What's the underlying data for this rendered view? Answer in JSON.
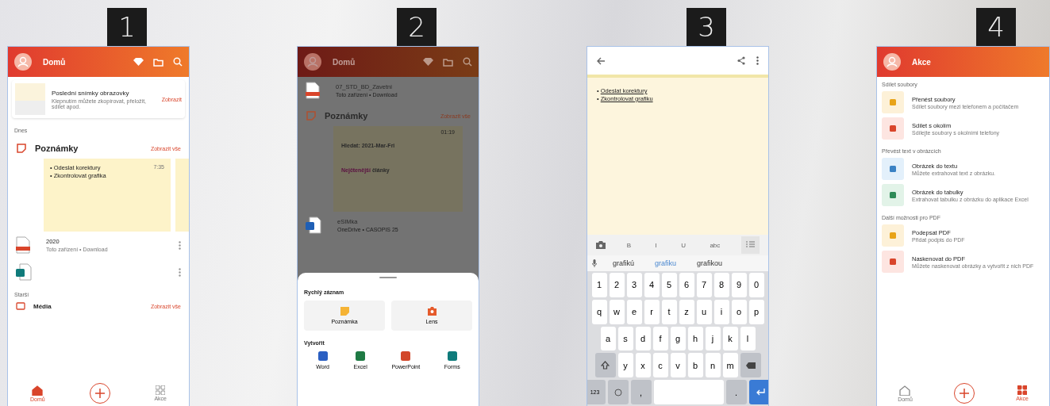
{
  "panels": [
    {
      "number": "1",
      "kind": "home",
      "header": {
        "title": "Domů"
      },
      "card": {
        "title": "Poslední snímky obrazovky",
        "description": "Klepnutím můžete zkopírovat, přeložit, sdílet apod.",
        "action": "Zobrazit"
      },
      "section_today": "Dnes",
      "notes": {
        "title": "Poznámky",
        "link": "Zobrazit vše",
        "time": "7:35",
        "bullet": "•",
        "items": [
          "Odeslat korektury",
          "Zkontrolovat grafika"
        ]
      },
      "files": [
        {
          "kind": "pdf",
          "name": "2020",
          "meta": "Toto zařízení • Download"
        },
        {
          "kind": "forms"
        }
      ],
      "section_older": "Starší",
      "media": {
        "title": "Média",
        "link": "Zobrazit vše"
      },
      "nav": [
        {
          "label": "Domů",
          "selected": true
        },
        {
          "label": "Akce",
          "selected": false
        }
      ]
    },
    {
      "number": "2",
      "kind": "sheet",
      "header": {
        "title": "Domů"
      },
      "files": [
        {
          "kind": "pdf",
          "name": "07_STD_BD_Zavetni",
          "meta": "Toto zařízení • Download"
        }
      ],
      "notes": {
        "title": "Poznámky",
        "link": "Zobrazit vše",
        "time": "01:19",
        "text": "Hledat: 2021-Mar-Fri",
        "highlight": "Nejčtenější",
        "rest": "články"
      },
      "file2": {
        "kind": "outlook",
        "name": "eSIMka",
        "meta": "OneDrive • CASOPIS 25"
      },
      "sheet": {
        "quick_title": "Rychlý záznam",
        "quick": [
          {
            "kind": "note",
            "label": "Poznámka"
          },
          {
            "kind": "lens",
            "label": "Lens"
          }
        ],
        "create_title": "Vytvořit",
        "apps": [
          {
            "kind": "word",
            "label": "Word"
          },
          {
            "kind": "excel",
            "label": "Excel"
          },
          {
            "kind": "powerpoint",
            "label": "PowerPoint"
          },
          {
            "kind": "forms",
            "label": "Forms"
          }
        ]
      }
    },
    {
      "number": "3",
      "kind": "editor",
      "bullet": "•",
      "lines": [
        "Odeslat korektury",
        "Zkontrolovat grafiku"
      ],
      "format": [
        {
          "kind": "camera"
        },
        {
          "kind": "text",
          "label": "B"
        },
        {
          "kind": "text",
          "label": "I"
        },
        {
          "kind": "text",
          "label": "U"
        },
        {
          "kind": "text",
          "label": "abc"
        },
        {
          "kind": "list"
        }
      ],
      "suggestions": [
        {
          "label": "grafikú",
          "selected": false
        },
        {
          "label": "grafiku",
          "selected": true
        },
        {
          "label": "grafikou",
          "selected": false
        }
      ],
      "keys": [
        [
          "1",
          "2",
          "3",
          "4",
          "5",
          "6",
          "7",
          "8",
          "9",
          "0"
        ],
        [
          "q",
          "w",
          "e",
          "r",
          "t",
          "z",
          "u",
          "i",
          "o",
          "p"
        ],
        [
          "a",
          "s",
          "d",
          "f",
          "g",
          "h",
          "j",
          "k",
          "l"
        ],
        [
          "y",
          "x",
          "c",
          "v",
          "b",
          "n",
          "m"
        ]
      ],
      "bottom_keys": {
        "numbers": "123",
        "comma": ",",
        "period": "."
      }
    },
    {
      "number": "4",
      "kind": "actions",
      "header": {
        "title": "Akce"
      },
      "sections": [
        {
          "title": "Sdílet soubory",
          "items": [
            {
              "kind": "transfer",
              "title": "Přenést soubory",
              "description": "Sdílet soubory mezi telefonem a počítačem"
            },
            {
              "kind": "nearby",
              "title": "Sdílet s okolím",
              "description": "Sdílejte soubory s okolními telefony"
            }
          ]
        },
        {
          "title": "Převést text v obrázcích",
          "items": [
            {
              "kind": "scan-text",
              "title": "Obrázek do textu",
              "description": "Můžete extrahovat text z obrázku."
            },
            {
              "kind": "scan-table",
              "title": "Obrázek do tabulky",
              "description": "Extrahovat tabulku z obrázku do aplikace Excel"
            }
          ]
        },
        {
          "title": "Další možnosti pro PDF",
          "items": [
            {
              "kind": "sign",
              "title": "Podepsat PDF",
              "description": "Přidat podpis do PDF"
            },
            {
              "kind": "scan-pdf",
              "title": "Naskenovat do PDF",
              "description": "Můžete naskenovat obrázky a vytvořit z nich PDF"
            }
          ]
        }
      ],
      "nav": [
        {
          "label": "Domů",
          "selected": false
        },
        {
          "label": "Akce",
          "selected": true
        }
      ]
    }
  ]
}
